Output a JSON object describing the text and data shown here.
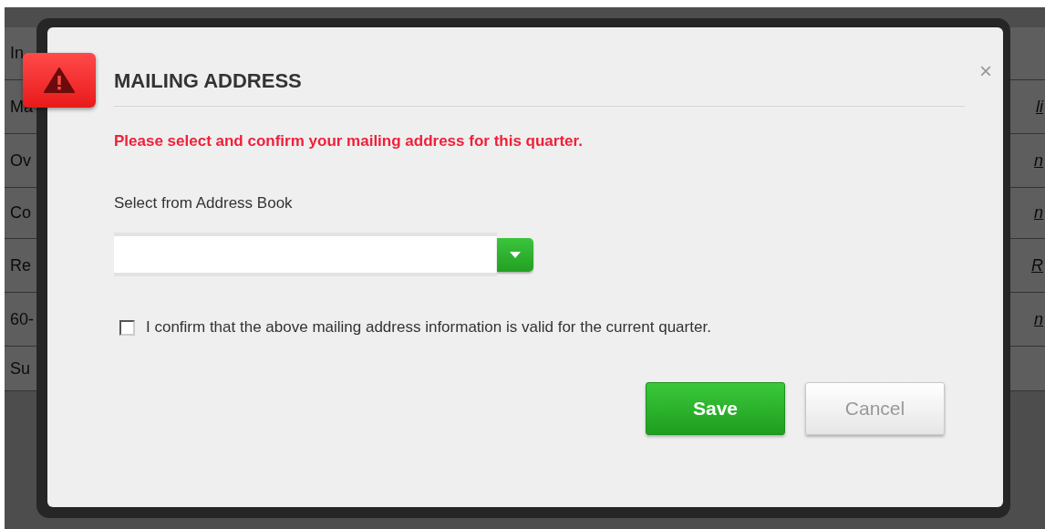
{
  "background_rows": [
    {
      "left": "In"
    },
    {
      "left": "Ma",
      "right": "li"
    },
    {
      "left": "Ov",
      "right": "n"
    },
    {
      "left": "Co",
      "right": "n"
    },
    {
      "left": "Re",
      "right": "R"
    },
    {
      "left": "60-",
      "right": "n"
    },
    {
      "left": "Su"
    }
  ],
  "dialog": {
    "title": "MAILING ADDRESS",
    "close": "×",
    "message": "Please select and confirm your mailing address for this quarter.",
    "address_select": {
      "label": "Select from Address Book"
    },
    "confirm": {
      "label": "I confirm that the above mailing address information is valid for the current quarter.",
      "checked": false
    },
    "buttons": [
      {
        "label": "Save",
        "kind": "primary"
      },
      {
        "label": "Cancel",
        "kind": "secondary"
      }
    ]
  }
}
